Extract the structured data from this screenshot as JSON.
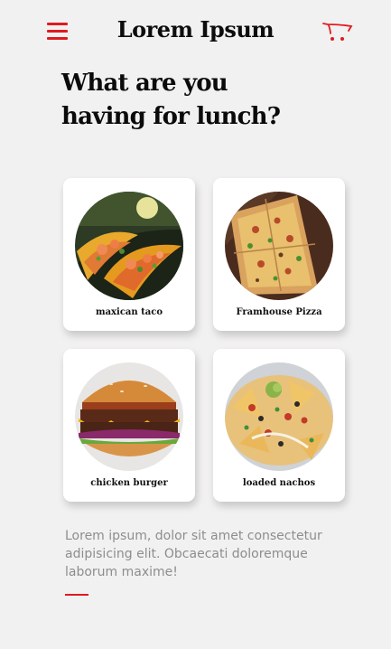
{
  "header": {
    "menu_icon": "hamburger-menu-icon",
    "title": "Lorem Ipsum",
    "cart_icon": "shopping-cart-icon"
  },
  "main": {
    "heading_line1": "What are you",
    "heading_line2": "having for lunch?",
    "cards": [
      {
        "label": "maxican taco",
        "image": "taco-image"
      },
      {
        "label": "Framhouse Pizza",
        "image": "pizza-image"
      },
      {
        "label": "chicken burger",
        "image": "burger-image"
      },
      {
        "label": "loaded nachos",
        "image": "nachos-image"
      }
    ],
    "description": "Lorem ipsum, dolor sit amet consectetur adipisicing elit. Obcaecati doloremque laborum maxime!"
  },
  "colors": {
    "accent": "#e01a1f",
    "background": "#f2f1f1",
    "card": "#ffffff",
    "text": "#0b0b0b",
    "muted_text": "#8d8d8d"
  }
}
